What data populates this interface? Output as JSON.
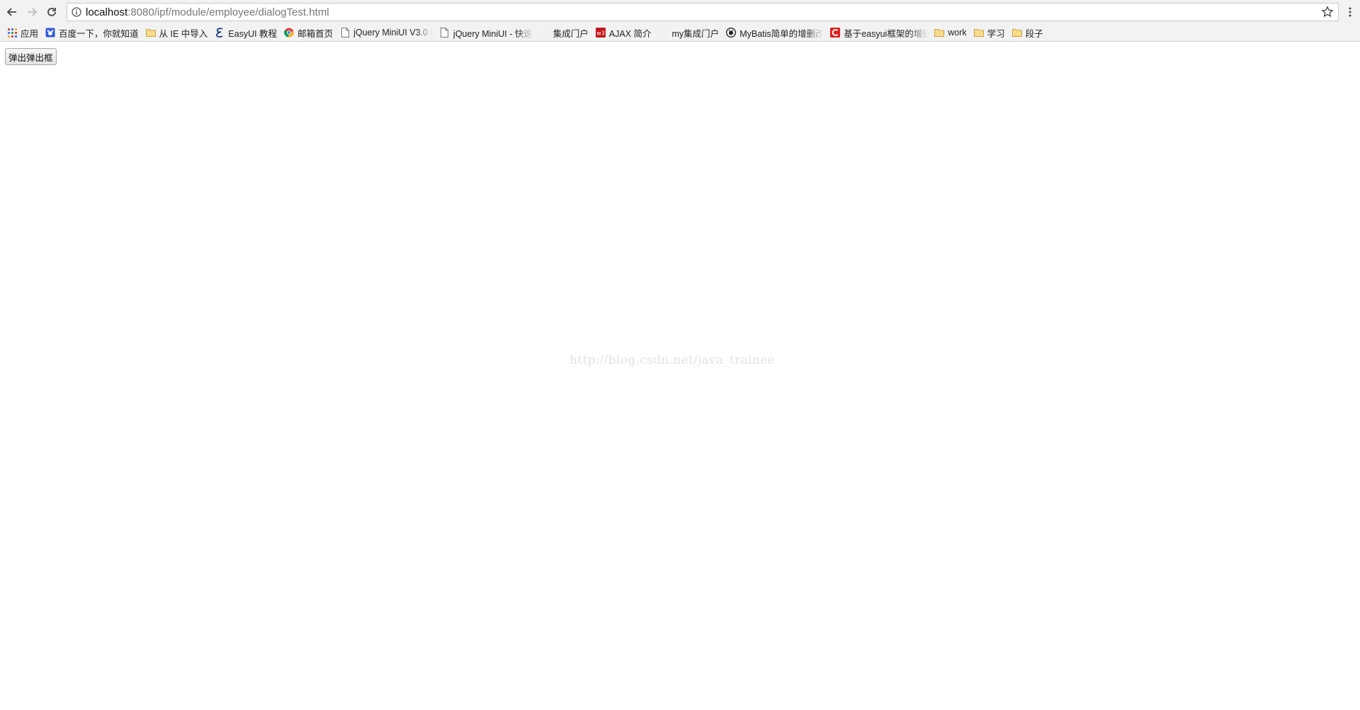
{
  "browser": {
    "url_host": "localhost",
    "url_path": ":8080/ipf/module/employee/dialogTest.html",
    "icons": {
      "back": "arrow-left-icon",
      "forward": "arrow-right-icon",
      "reload": "reload-icon",
      "info": "info-icon",
      "star": "star-icon",
      "menu": "three-dots-icon"
    }
  },
  "bookmarks": [
    {
      "label": "应用",
      "icon": "apps-grid-icon"
    },
    {
      "label": "百度一下，你就知道",
      "icon": "baidu-icon"
    },
    {
      "label": "从 IE 中导入",
      "icon": "folder-icon"
    },
    {
      "label": "EasyUI 教程",
      "icon": "easyui-icon"
    },
    {
      "label": "邮箱首页",
      "icon": "chrome-icon"
    },
    {
      "label": "jQuery MiniUI V3.0 I",
      "icon": "page-icon"
    },
    {
      "label": "jQuery MiniUI - 快速",
      "icon": "page-icon"
    },
    {
      "label": "集成门户",
      "icon": "blank-icon"
    },
    {
      "label": "AJAX 简介",
      "icon": "w3-icon"
    },
    {
      "label": "my集成门户",
      "icon": "blank-icon"
    },
    {
      "label": "MyBatis简单的增删改",
      "icon": "github-icon"
    },
    {
      "label": "基于easyui框架的增删",
      "icon": "csdn-icon"
    },
    {
      "label": "work",
      "icon": "folder-icon"
    },
    {
      "label": "学习",
      "icon": "folder-icon"
    },
    {
      "label": "段子",
      "icon": "folder-icon"
    }
  ],
  "page": {
    "popup_button_label": "弹出弹出框",
    "watermark": "http://blog.csdn.net/java_trainee"
  },
  "colors": {
    "chrome_bg": "#f2f2f2",
    "folder": "#f0c75e",
    "w3": "#c4161c",
    "csdn": "#e0201b",
    "baidu": "#2f5bdb"
  }
}
